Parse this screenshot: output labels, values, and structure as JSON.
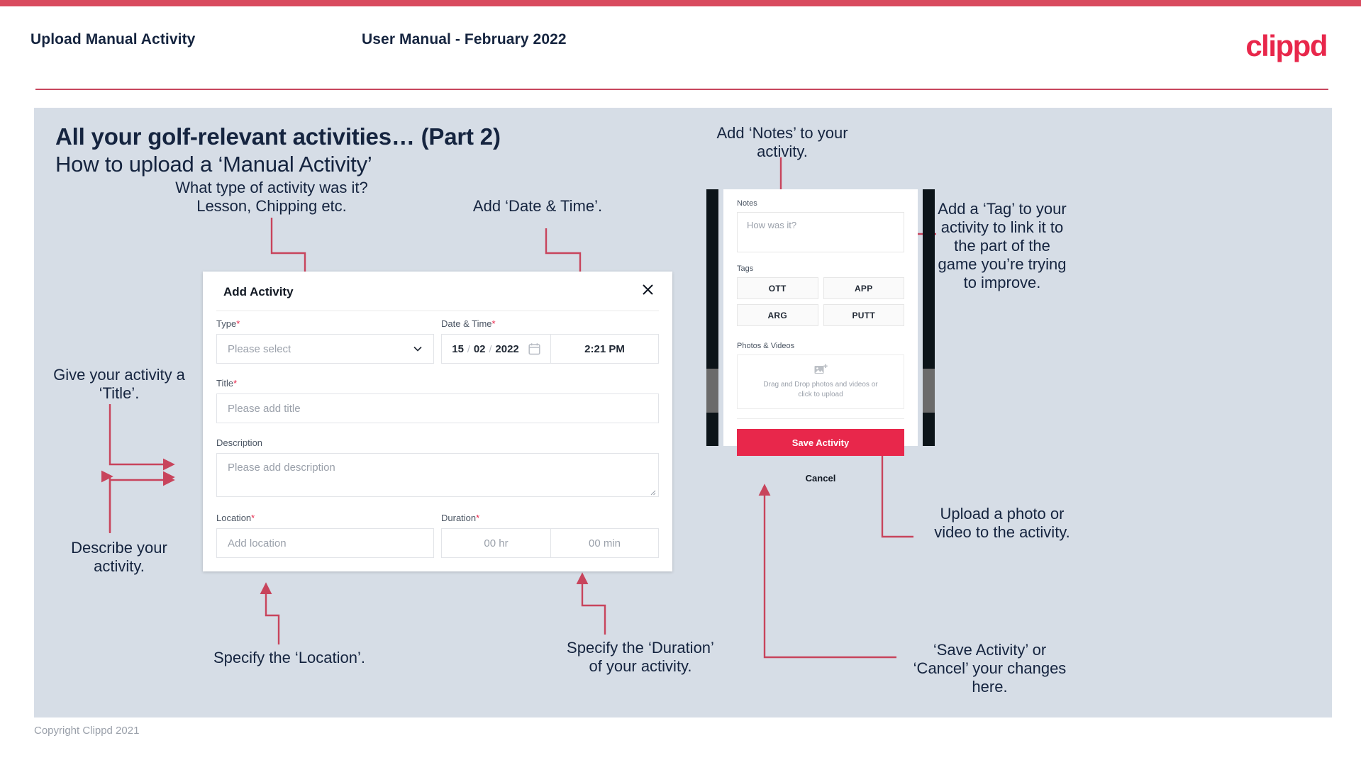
{
  "header": {
    "title": "Upload Manual Activity",
    "subtitle": "User Manual - February 2022",
    "logo": "clippd"
  },
  "slide": {
    "heading": "All your golf-relevant activities… (Part 2)",
    "subheading": "How to upload a ‘Manual Activity’"
  },
  "annotations": {
    "type": "What type of activity was it?\nLesson, Chipping etc.",
    "datetime": "Add ‘Date & Time’.",
    "title": "Give your activity a\n‘Title’.",
    "description": "Describe your\nactivity.",
    "location": "Specify the ‘Location’.",
    "duration": "Specify the ‘Duration’\nof your activity.",
    "notes": "Add ‘Notes’ to your\nactivity.",
    "tags": "Add a ‘Tag’ to your\nactivity to link it to\nthe part of the\ngame you’re trying\nto improve.",
    "upload": "Upload a photo or\nvideo to the activity.",
    "savecancel": "‘Save Activity’ or\n‘Cancel’ your changes\nhere."
  },
  "dialog": {
    "title": "Add Activity",
    "close_icon": "close-icon",
    "fields": {
      "type": {
        "label": "Type",
        "required": "*",
        "placeholder": "Please select",
        "icon": "chevron-down-icon"
      },
      "datetime": {
        "label": "Date & Time",
        "required": "*",
        "day": "15",
        "month": "02",
        "year": "2022",
        "sep": "/",
        "icon": "calendar-icon",
        "time": "2:21 PM"
      },
      "title": {
        "label": "Title",
        "required": "*",
        "placeholder": "Please add title"
      },
      "description": {
        "label": "Description",
        "required": "",
        "placeholder": "Please add description"
      },
      "location": {
        "label": "Location",
        "required": "*",
        "placeholder": "Add location"
      },
      "duration": {
        "label": "Duration",
        "required": "*",
        "hours_placeholder": "00 hr",
        "minutes_placeholder": "00 min"
      }
    }
  },
  "phone": {
    "notes": {
      "label": "Notes",
      "placeholder": "How was it?"
    },
    "tags": {
      "label": "Tags",
      "items": [
        "OTT",
        "APP",
        "ARG",
        "PUTT"
      ]
    },
    "photos": {
      "label": "Photos & Videos",
      "icon": "add-image-icon",
      "dropzone_text": "Drag and Drop photos and videos or\nclick to upload"
    },
    "save_label": "Save Activity",
    "cancel_label": "Cancel"
  },
  "footer": {
    "copyright": "Copyright Clippd 2021"
  },
  "colors": {
    "accent": "#e8274b",
    "accent_rule": "#c7475e",
    "slide_bg": "#d6dde6",
    "text_dark": "#15243f",
    "arrow": "#c8445c"
  }
}
